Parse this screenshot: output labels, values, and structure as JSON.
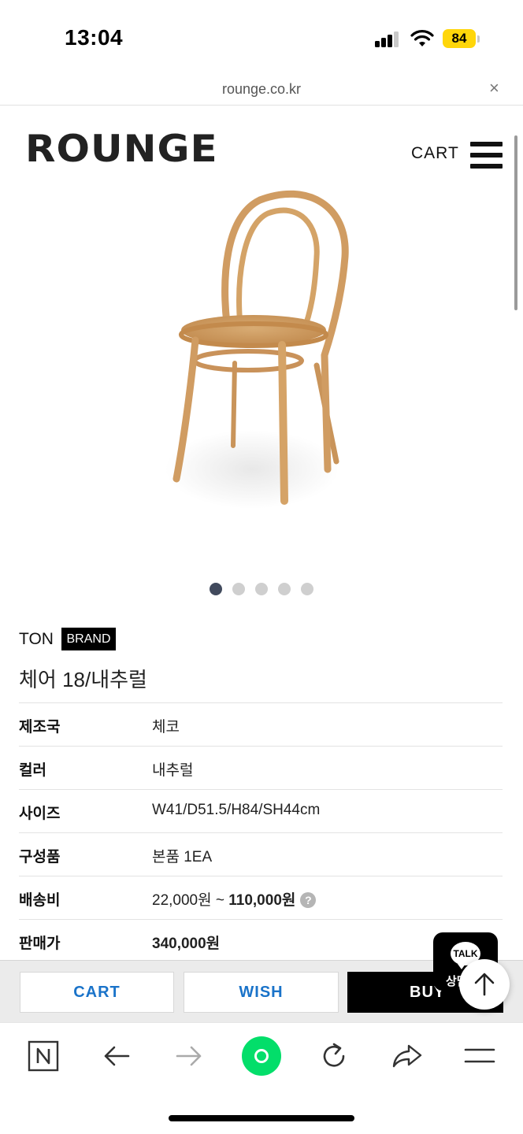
{
  "status_bar": {
    "time": "13:04",
    "battery": "84"
  },
  "url_bar": {
    "url": "rounge.co.kr",
    "close_glyph": "×"
  },
  "header": {
    "logo": "ROUNGE",
    "cart_label": "CART"
  },
  "product_image": {
    "description_icon": "bentwood-chair-image",
    "wood_color": "#d4a060"
  },
  "gallery": {
    "count": 5,
    "active_index": 0
  },
  "product": {
    "brand": "TON",
    "brand_badge": "BRAND",
    "title": "체어 18/내추럴"
  },
  "info_rows": [
    {
      "label": "제조국",
      "value": "체코"
    },
    {
      "label": "컬러",
      "value": "내추럴"
    },
    {
      "label": "사이즈",
      "value": "W41/D51.5/H84/SH44cm"
    },
    {
      "label": "구성품",
      "value": "본품 1EA"
    },
    {
      "label": "배송비",
      "value_prefix": "22,000원 ~ ",
      "value_bold": "110,000원",
      "help_glyph": "?"
    },
    {
      "label": "판매가",
      "value_bold": "340,000원"
    }
  ],
  "actions": {
    "cart": "CART",
    "wish": "WISH",
    "buy": "BUY"
  },
  "talk_widget": {
    "bubble": "TALK",
    "sub": "상담"
  },
  "colors": {
    "accent_blue": "#1a73c9",
    "naver_green": "#03de6a",
    "battery_yellow": "#ffd60a"
  }
}
